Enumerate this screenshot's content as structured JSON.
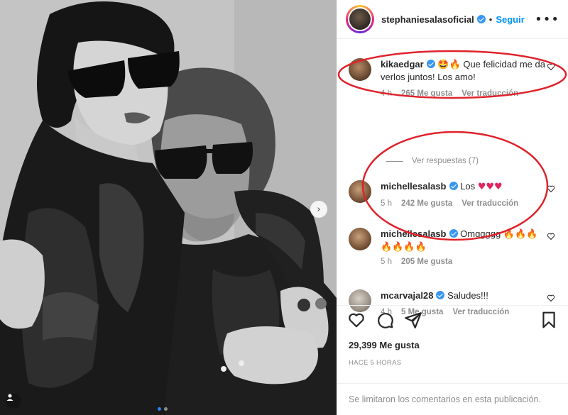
{
  "post": {
    "username": "stephaniesalasoficial",
    "separator": "•",
    "follow_label": "Seguir",
    "more_label": "•••",
    "next_label": "›"
  },
  "comments": [
    {
      "username": "kikaedgar",
      "emoji": "🤩🔥",
      "text": "Que felicidad me da verlos juntos! Los amo!",
      "time": "4 h",
      "likes": "265 Me gusta",
      "translate": "Ver traducción"
    },
    {
      "username": "michellesalasb",
      "text": "Los",
      "emoji": "♥♥♥",
      "time": "5 h",
      "likes": "242 Me gusta",
      "translate": "Ver traducción"
    },
    {
      "username": "michellesalasb",
      "text": "Omggggg",
      "emoji": "🔥🔥🔥",
      "emoji_line2": "🔥🔥🔥🔥",
      "time": "5 h",
      "likes": "205 Me gusta"
    },
    {
      "username": "mcarvajal28",
      "text": "Saludes!!!",
      "time": "4 h",
      "likes": "5 Me gusta",
      "translate": "Ver traducción"
    }
  ],
  "replies_label": "Ver respuestas (7)",
  "likes_total": "29,399 Me gusta",
  "time_ago": "HACE 5 HORAS",
  "footer_note": "Se limitaron los comentarios en esta publicación.",
  "colors": {
    "accent": "#0095f6",
    "annotation": "#e0222b",
    "verified": "#3897f0"
  },
  "icons": [
    "heart-icon",
    "comment-icon",
    "share-icon",
    "bookmark-icon",
    "tag-person-icon",
    "chevron-right-icon",
    "verified-icon"
  ]
}
